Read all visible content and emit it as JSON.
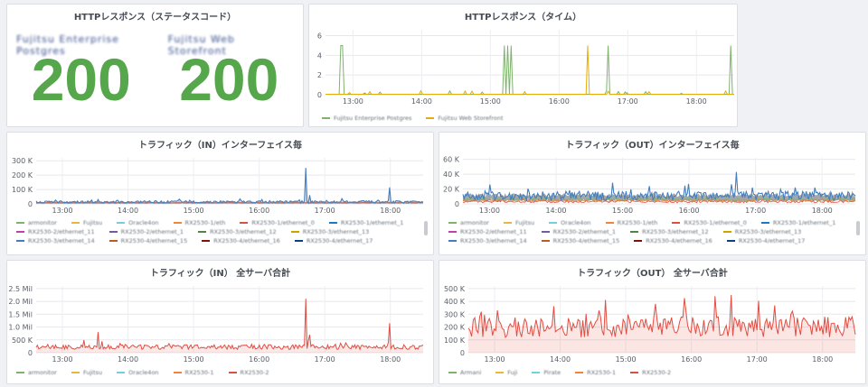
{
  "panels": {
    "status": {
      "title": "HTTPレスポンス（ステータスコード）",
      "stats": [
        {
          "label": "Fujitsu Enterprise Postgres",
          "value": "200"
        },
        {
          "label": "Fujitsu Web Storefront",
          "value": "200"
        }
      ],
      "value_color": "#56a64b"
    },
    "time": {
      "title": "HTTPレスポンス（タイム）",
      "legend": [
        {
          "name": "Fujitsu Enterprise Postgres",
          "color": "#7eb26d"
        },
        {
          "name": "Fujitsu Web Storefront",
          "color": "#e5ac0e"
        }
      ]
    },
    "traffic_in_if": {
      "title": "トラフィック（IN）インターフェイス毎",
      "legend": [
        {
          "name": "armonitor",
          "color": "#7eb26d"
        },
        {
          "name": "Fujitsu",
          "color": "#eab839"
        },
        {
          "name": "Oracle4on",
          "color": "#6ed0e0"
        },
        {
          "name": "RX2530-1/eth",
          "color": "#ef843c"
        },
        {
          "name": "RX2530-1/ethernet_0",
          "color": "#e24d42"
        },
        {
          "name": "RX2530-1/ethernet_1",
          "color": "#1f78c1"
        },
        {
          "name": "RX2530-2/ethernet_11",
          "color": "#ba43a9"
        },
        {
          "name": "RX2530-2/ethernet_1",
          "color": "#705da0"
        },
        {
          "name": "RX2530-3/ethernet_12",
          "color": "#508642"
        },
        {
          "name": "RX2530-3/ethernet_13",
          "color": "#cca300"
        },
        {
          "name": "RX2530-3/ethernet_14",
          "color": "#447ebc"
        },
        {
          "name": "RX2530-4/ethernet_15",
          "color": "#c15c17"
        },
        {
          "name": "RX2530-4/ethernet_16",
          "color": "#890f02"
        },
        {
          "name": "RX2530-4/ethernet_17",
          "color": "#0a437c"
        }
      ]
    },
    "traffic_out_if": {
      "title": "トラフィック（OUT）インターフェイス毎",
      "legend": [
        {
          "name": "armonitor",
          "color": "#7eb26d"
        },
        {
          "name": "Fujitsu",
          "color": "#eab839"
        },
        {
          "name": "Oracle4on",
          "color": "#6ed0e0"
        },
        {
          "name": "RX2530-1/eth",
          "color": "#ef843c"
        },
        {
          "name": "RX2530-1/ethernet_0",
          "color": "#e24d42"
        },
        {
          "name": "RX2530-1/ethernet_1",
          "color": "#1f78c1"
        },
        {
          "name": "RX2530-2/ethernet_11",
          "color": "#ba43a9"
        },
        {
          "name": "RX2530-2/ethernet_1",
          "color": "#705da0"
        },
        {
          "name": "RX2530-3/ethernet_12",
          "color": "#508642"
        },
        {
          "name": "RX2530-3/ethernet_13",
          "color": "#cca300"
        },
        {
          "name": "RX2530-3/ethernet_14",
          "color": "#447ebc"
        },
        {
          "name": "RX2530-4/ethernet_15",
          "color": "#c15c17"
        },
        {
          "name": "RX2530-4/ethernet_16",
          "color": "#890f02"
        },
        {
          "name": "RX2530-4/ethernet_17",
          "color": "#0a437c"
        }
      ]
    },
    "traffic_in_total": {
      "title": "トラフィック（IN） 全サーバ合計",
      "legend": [
        {
          "name": "armonitor",
          "color": "#7eb26d"
        },
        {
          "name": "Fujitsu",
          "color": "#eab839"
        },
        {
          "name": "Oracle4on",
          "color": "#6ed0e0"
        },
        {
          "name": "RX2530-1",
          "color": "#ef843c"
        },
        {
          "name": "RX2530-2",
          "color": "#e24d42"
        }
      ]
    },
    "traffic_out_total": {
      "title": "トラフィック（OUT） 全サーバ合計",
      "legend": [
        {
          "name": "Armani",
          "color": "#7eb26d"
        },
        {
          "name": "Fuji",
          "color": "#eab839"
        },
        {
          "name": "Pirate",
          "color": "#6ed0e0"
        },
        {
          "name": "RX2530-1",
          "color": "#ef843c"
        },
        {
          "name": "RX2530-2",
          "color": "#e24d42"
        }
      ]
    }
  },
  "chart_data": [
    {
      "type": "line",
      "title": "HTTPレスポンス（タイム）",
      "x_ticks": [
        "13:00",
        "14:00",
        "15:00",
        "16:00",
        "17:00",
        "18:00"
      ],
      "y_ticks": [
        "0",
        "2",
        "4",
        "6"
      ],
      "ylim": [
        0,
        6.6
      ],
      "xlim": [
        12.6,
        18.55
      ],
      "series": [
        {
          "name": "Fujitsu Enterprise Postgres",
          "color": "#7eb26d",
          "baseline": 0.05,
          "spikes": [
            [
              12.82,
              5.0
            ],
            [
              12.86,
              5.0
            ],
            [
              15.2,
              5.0
            ],
            [
              15.25,
              5.0
            ],
            [
              15.31,
              5.0
            ],
            [
              16.72,
              5.0
            ],
            [
              18.5,
              5.0
            ]
          ]
        },
        {
          "name": "Fujitsu Web Storefront",
          "color": "#e5ac0e",
          "baseline": 0.05,
          "spikes": [
            [
              14.0,
              0.4
            ],
            [
              15.5,
              0.3
            ],
            [
              16.42,
              5.0
            ],
            [
              17.0,
              0.2
            ]
          ]
        }
      ]
    },
    {
      "type": "line",
      "title": "トラフィック（IN）インターフェイス毎",
      "x_ticks": [
        "13:00",
        "14:00",
        "15:00",
        "16:00",
        "17:00",
        "18:00"
      ],
      "y_ticks": [
        "0",
        "100 K",
        "200 K",
        "300 K"
      ],
      "ylim": [
        0,
        320000
      ],
      "xlim": [
        12.6,
        18.5
      ],
      "main_color": "#447ebc",
      "baseline": 14000,
      "noise": 8000,
      "spikes": [
        [
          13.55,
          30000
        ],
        [
          14.95,
          25000
        ],
        [
          16.05,
          30000
        ],
        [
          16.72,
          250000
        ],
        [
          16.76,
          60000
        ],
        [
          17.98,
          115000
        ]
      ]
    },
    {
      "type": "area",
      "title": "トラフィック（OUT）インターフェイス毎",
      "x_ticks": [
        "13:00",
        "14:00",
        "15:00",
        "16:00",
        "17:00",
        "18:00"
      ],
      "y_ticks": [
        "0",
        "20 K",
        "40 K",
        "60 K"
      ],
      "ylim": [
        0,
        62000
      ],
      "xlim": [
        12.6,
        18.5
      ],
      "main_color": "#447ebc",
      "band_low": 4000,
      "band_high": 12000,
      "noise": 6000,
      "spikes": [
        [
          16.72,
          43000
        ],
        [
          13.0,
          26000
        ],
        [
          15.4,
          24000
        ],
        [
          17.6,
          22000
        ]
      ]
    },
    {
      "type": "line",
      "title": "トラフィック（IN） 全サーバ合計",
      "x_ticks": [
        "13:00",
        "14:00",
        "15:00",
        "16:00",
        "17:00",
        "18:00"
      ],
      "y_ticks": [
        "0",
        "500 K",
        "1.0 Mil",
        "1.5 Mil",
        "2.0 Mil",
        "2.5 Mil"
      ],
      "ylim": [
        0,
        2600000
      ],
      "xlim": [
        12.6,
        18.5
      ],
      "main_color": "#e24d42",
      "baseline": 220000,
      "noise": 90000,
      "spikes": [
        [
          13.55,
          800000
        ],
        [
          16.72,
          2100000
        ],
        [
          16.76,
          700000
        ],
        [
          17.98,
          1150000
        ]
      ]
    },
    {
      "type": "area",
      "title": "トラフィック（OUT） 全サーバ合計",
      "x_ticks": [
        "13:00",
        "14:00",
        "15:00",
        "16:00",
        "17:00",
        "18:00"
      ],
      "y_ticks": [
        "0",
        "100 K",
        "200 K",
        "300 K",
        "400 K",
        "500 K"
      ],
      "ylim": [
        0,
        520000
      ],
      "xlim": [
        12.6,
        18.5
      ],
      "main_color": "#e24d42",
      "baseline": 200000,
      "noise": 80000,
      "spikes": [
        [
          16.35,
          440000
        ],
        [
          16.6,
          450000
        ],
        [
          15.45,
          380000
        ],
        [
          13.05,
          330000
        ]
      ]
    }
  ]
}
